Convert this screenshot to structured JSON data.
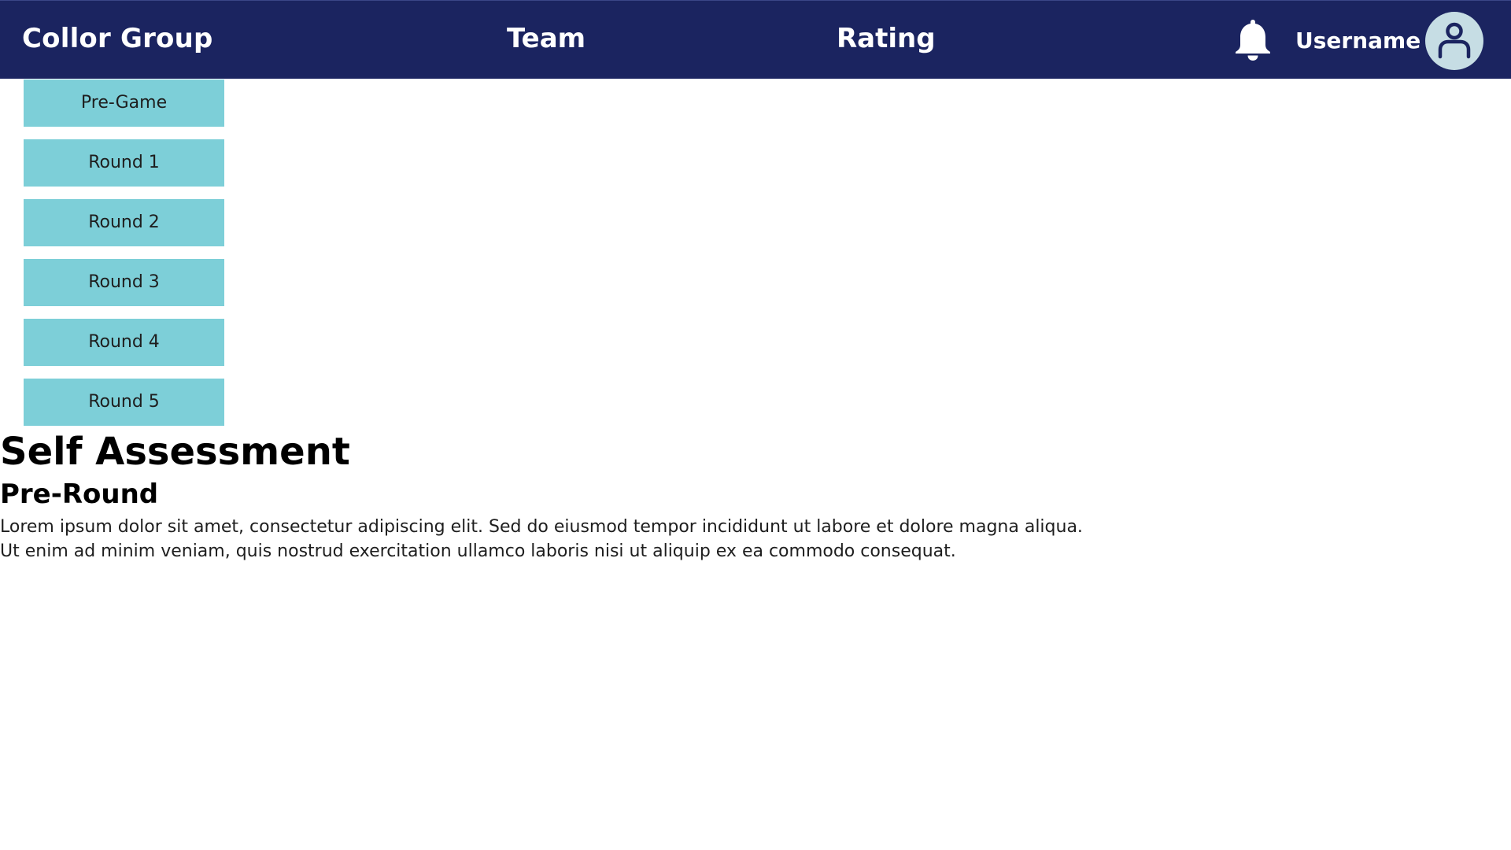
{
  "header": {
    "brand": "Collor Group",
    "nav": [
      {
        "label": "Team"
      },
      {
        "label": "Rating"
      }
    ],
    "notification_icon": "bell-icon",
    "username": "Username",
    "avatar_icon": "user-icon"
  },
  "rounds": [
    {
      "label": "Pre-Game"
    },
    {
      "label": "Round 1"
    },
    {
      "label": "Round 2"
    },
    {
      "label": "Round 3"
    },
    {
      "label": "Round 4"
    },
    {
      "label": "Round 5"
    }
  ],
  "main": {
    "title": "Self Assessment",
    "subtitle": "Pre-Round",
    "paragraph_lines": [
      "Lorem ipsum dolor sit amet, consectetur adipiscing elit. Sed do eiusmod tempor incididunt ut labore et dolore magna aliqua.",
      "Ut enim ad minim veniam, quis nostrud exercitation ullamco laboris nisi ut aliquip ex ea commodo consequat."
    ]
  },
  "colors": {
    "navbar_bg": "#1b2460",
    "button_bg": "#7dcfd8",
    "avatar_bg": "#c6dde4"
  }
}
